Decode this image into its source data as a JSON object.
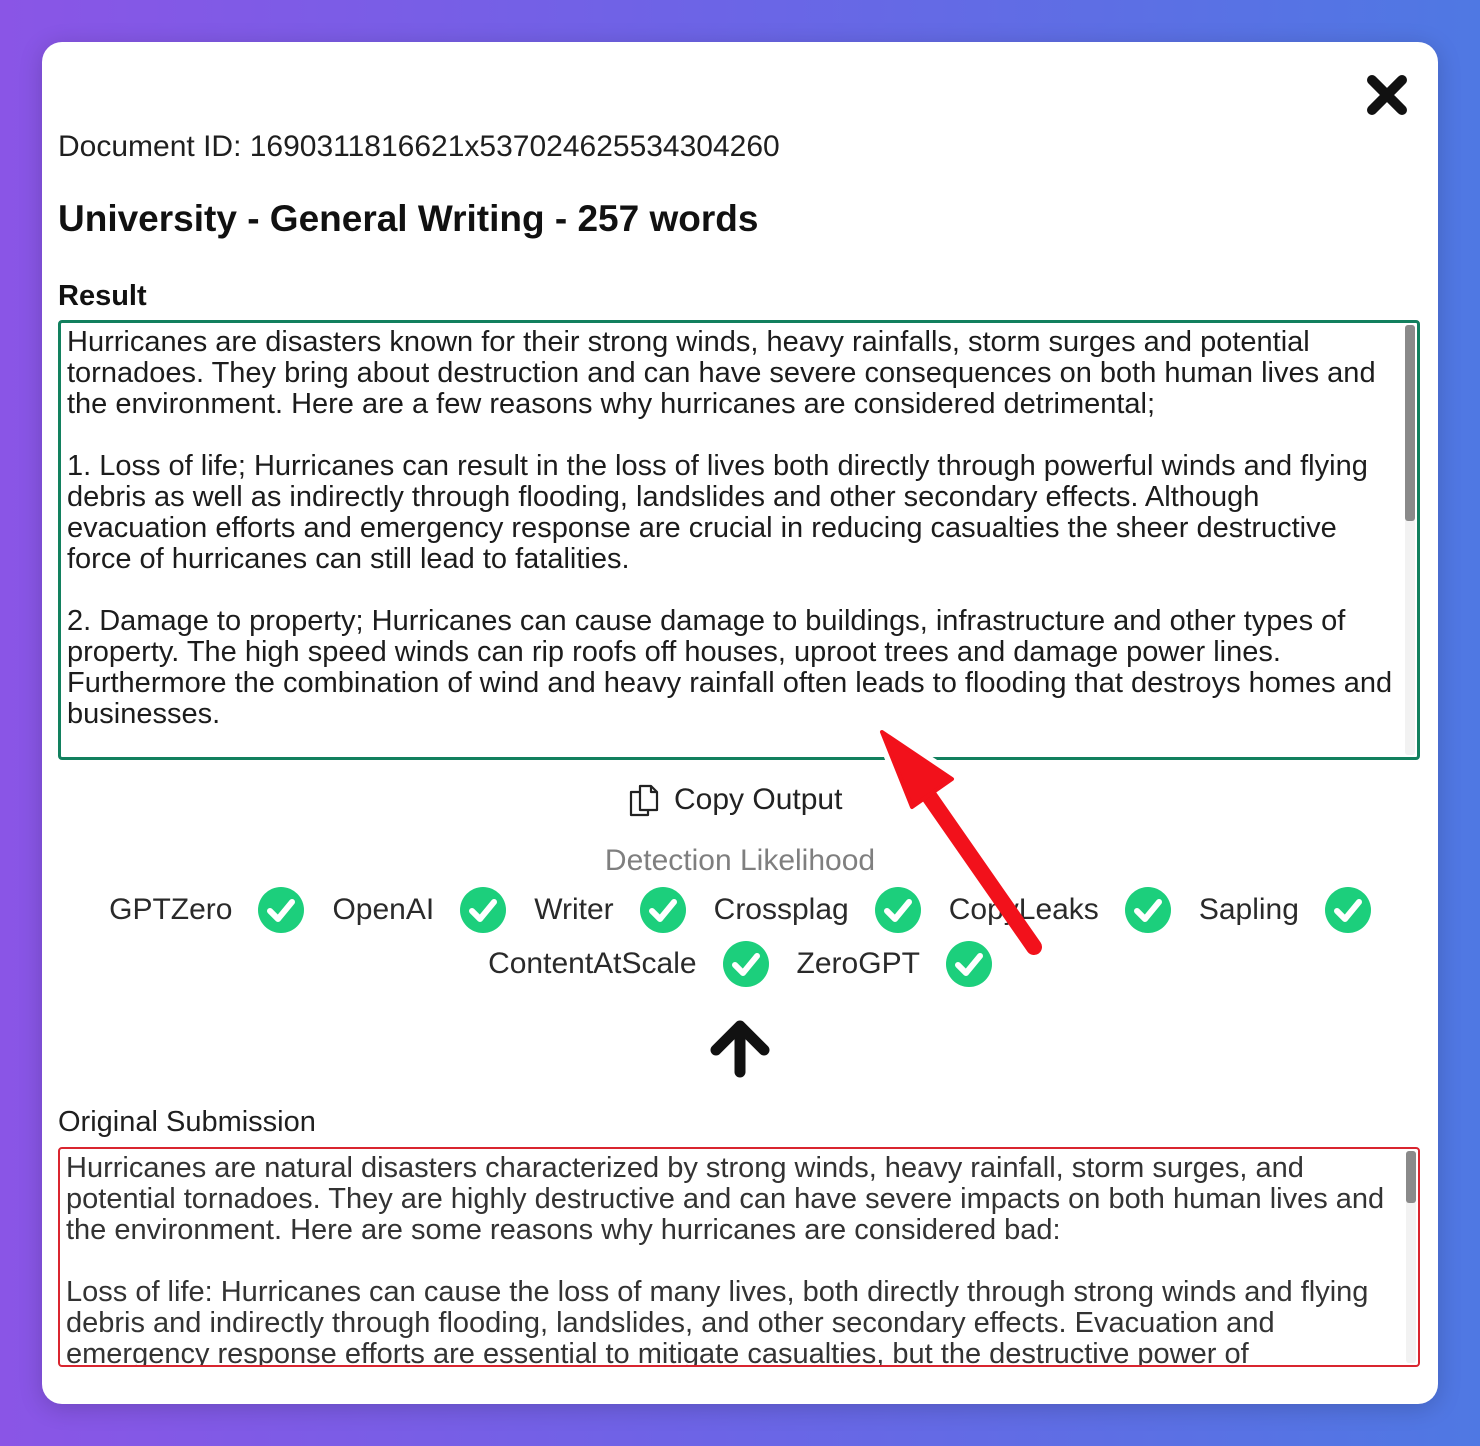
{
  "header": {
    "document_id": "Document ID: 1690311816621x537024625534304260",
    "title": "University - General Writing - 257 words"
  },
  "result": {
    "label": "Result",
    "text": "Hurricanes are disasters known for their strong winds, heavy rainfalls, storm surges and potential tornadoes. They bring about destruction and can have severe consequences on both human lives and the environment. Here are a few reasons why hurricanes are considered detrimental;\n\n1. Loss of life; Hurricanes can result in the loss of lives both directly through powerful winds and flying debris as well as indirectly through flooding, landslides and other secondary effects. Although evacuation efforts and emergency response are crucial in reducing casualties the sheer destructive force of hurricanes can still lead to fatalities.\n\n2. Damage to property; Hurricanes can cause damage to buildings, infrastructure and other types of property. The high speed winds can rip roofs off houses, uproot trees and damage power lines. Furthermore the combination of wind and heavy rainfall often leads to flooding that destroys homes and businesses."
  },
  "copy_output": {
    "label": "Copy Output",
    "icon": "copy-icon"
  },
  "detection": {
    "title": "Detection Likelihood",
    "detectors": [
      {
        "name": "GPTZero",
        "status": "passed"
      },
      {
        "name": "OpenAI",
        "status": "passed"
      },
      {
        "name": "Writer",
        "status": "passed"
      },
      {
        "name": "Crossplag",
        "status": "passed"
      },
      {
        "name": "CopyLeaks",
        "status": "passed"
      },
      {
        "name": "Sapling",
        "status": "passed"
      },
      {
        "name": "ContentAtScale",
        "status": "passed"
      },
      {
        "name": "ZeroGPT",
        "status": "passed"
      }
    ]
  },
  "original": {
    "label": "Original Submission",
    "text": "Hurricanes are natural disasters characterized by strong winds, heavy rainfall, storm surges, and potential tornadoes. They are highly destructive and can have severe impacts on both human lives and the environment. Here are some reasons why hurricanes are considered bad:\n\nLoss of life: Hurricanes can cause the loss of many lives, both directly through strong winds and flying debris and indirectly through flooding, landslides, and other secondary effects. Evacuation and emergency response efforts are essential to mitigate casualties, but the destructive power of"
  },
  "colors": {
    "result_border": "#12805e",
    "original_border": "#d9252f",
    "check_green": "#1ccf7c",
    "annotation_arrow": "#f2111b"
  }
}
